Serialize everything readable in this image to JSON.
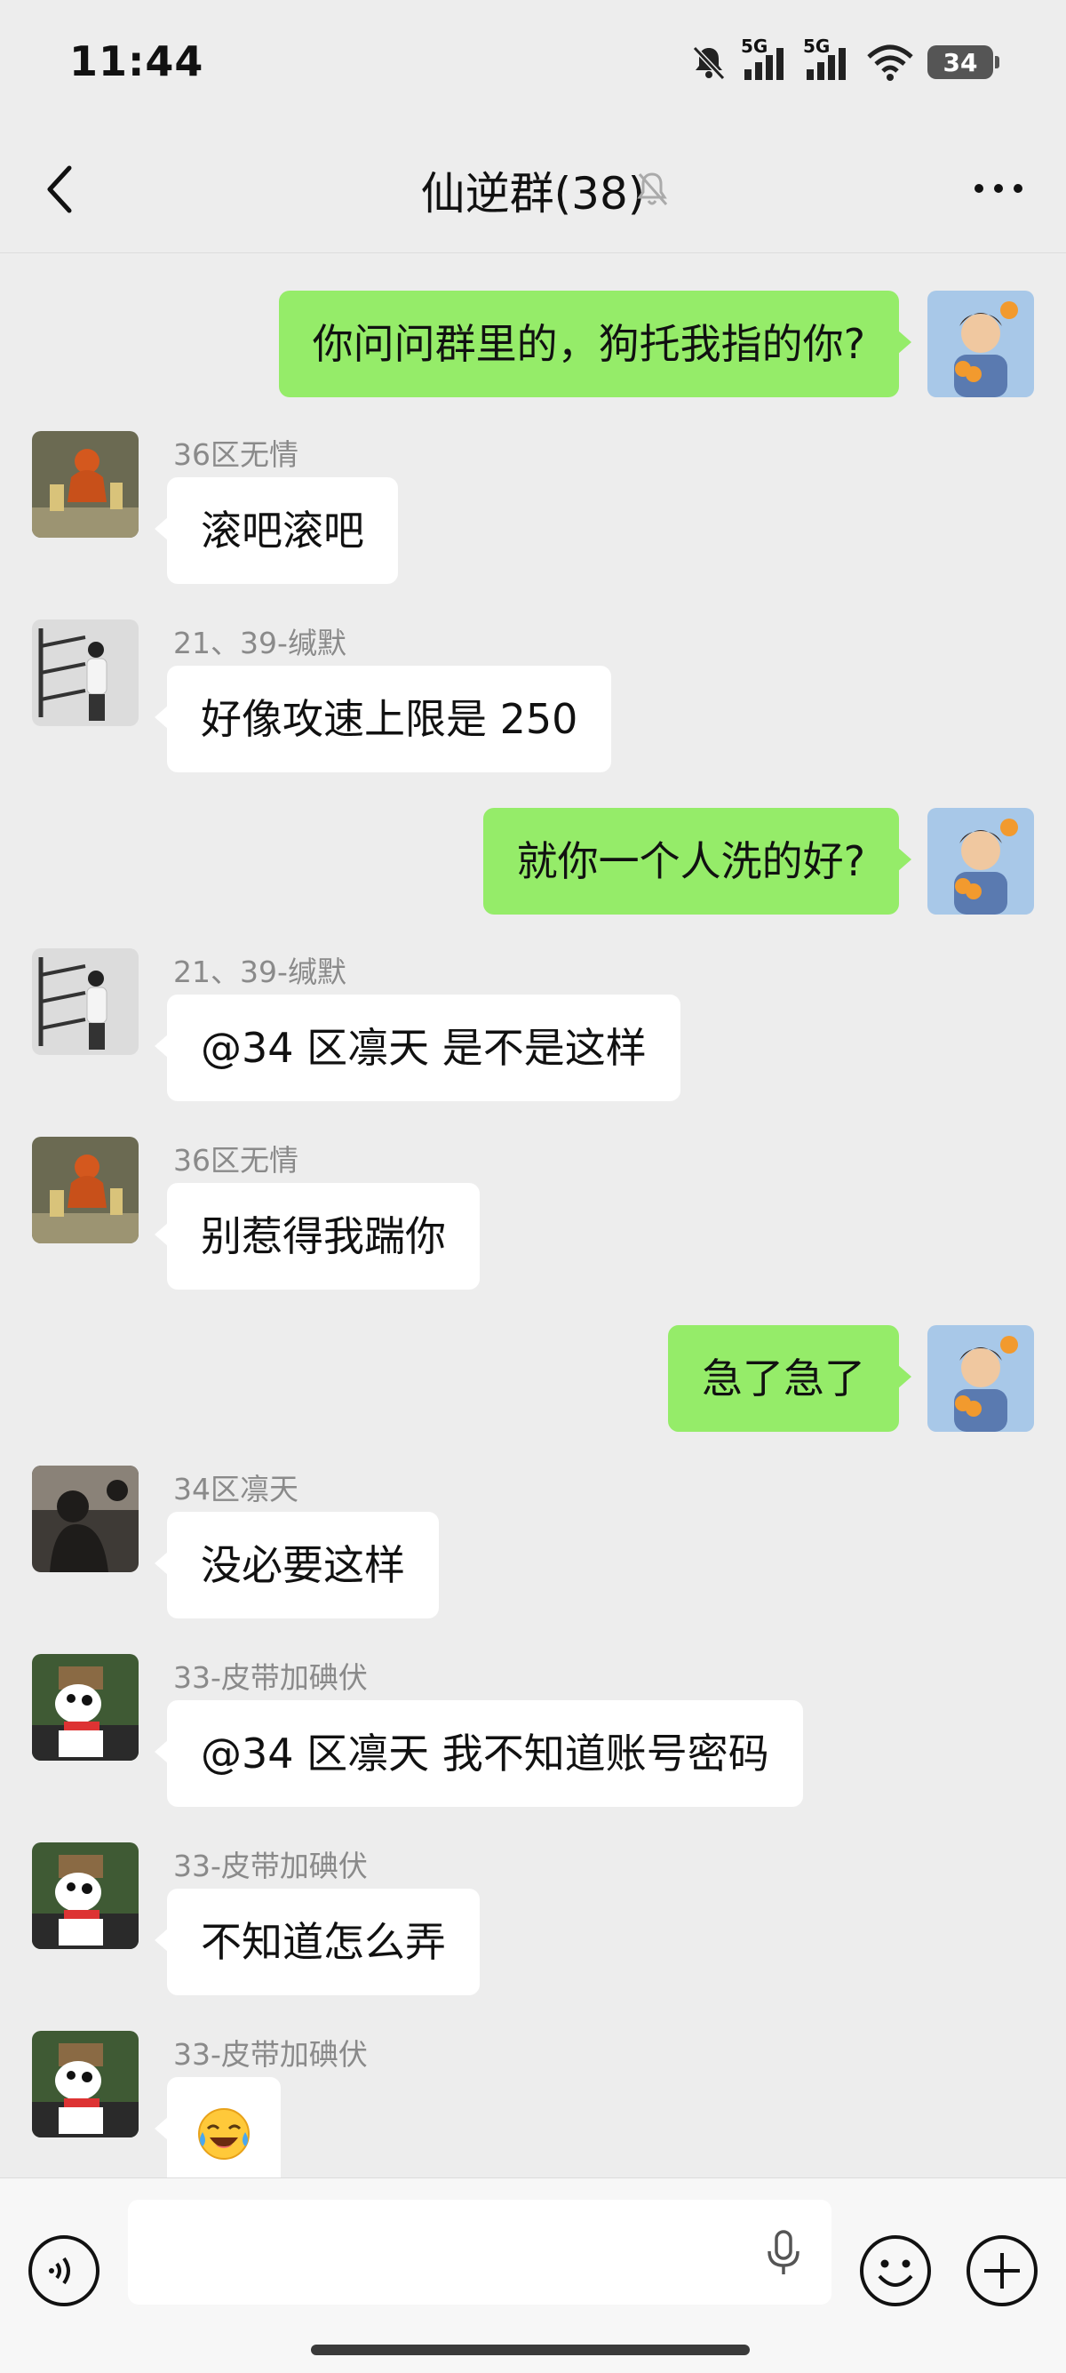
{
  "status": {
    "time": "11:44",
    "network1": "5G",
    "network2": "5G",
    "battery": "34"
  },
  "header": {
    "title": "仙逆群(38)"
  },
  "messages": [
    {
      "dir": "out",
      "text": "你问问群里的，狗托我指的你?"
    },
    {
      "dir": "in",
      "sender": "36区无情",
      "text": "滚吧滚吧"
    },
    {
      "dir": "in",
      "sender": "21、39-缄默",
      "text": "好像攻速上限是 250"
    },
    {
      "dir": "out",
      "text": "就你一个人洗的好?"
    },
    {
      "dir": "in",
      "sender": "21、39-缄默",
      "text": "@34 区凛天  是不是这样"
    },
    {
      "dir": "in",
      "sender": "36区无情",
      "text": "别惹得我踹你"
    },
    {
      "dir": "out",
      "text": "急了急了"
    },
    {
      "dir": "in",
      "sender": "34区凛天",
      "text": "没必要这样"
    },
    {
      "dir": "in",
      "sender": "33-皮带加碘伏",
      "text": "@34 区凛天  我不知道账号密码"
    },
    {
      "dir": "in",
      "sender": "33-皮带加碘伏",
      "text": "不知道怎么弄"
    },
    {
      "dir": "in",
      "sender": "33-皮带加碘伏",
      "emoji": "laughing-crying-face"
    }
  ],
  "input": {
    "placeholder": ""
  },
  "colors": {
    "background": "#ededed",
    "outgoing_bubble": "#95ec69",
    "incoming_bubble": "#ffffff"
  }
}
